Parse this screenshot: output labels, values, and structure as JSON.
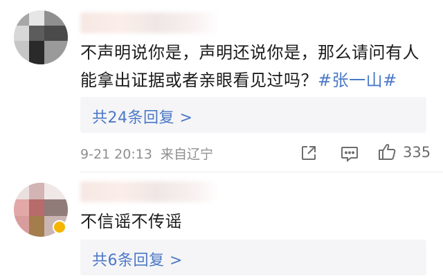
{
  "comments": [
    {
      "text": "不声明说你是，声明还说你是，那么请问有人能拿出证据或者亲眼看见过吗？",
      "topic": "#张一山#",
      "replies_label": "共24条回复 >",
      "timestamp": "9-21 20:13",
      "source": "来自辽宁",
      "like_count": "335",
      "icons": [
        "share-icon",
        "comment-icon",
        "thumbs-up-icon"
      ]
    },
    {
      "text": "不信谣不传谣",
      "replies_label": "共6条回复 >",
      "avatar_badge": "verified-badge-icon"
    }
  ],
  "colors": {
    "link": "#4b78c7",
    "meta": "#8f8f8f",
    "reply_box": "#f5f5f7",
    "badge": "#f4b400"
  }
}
